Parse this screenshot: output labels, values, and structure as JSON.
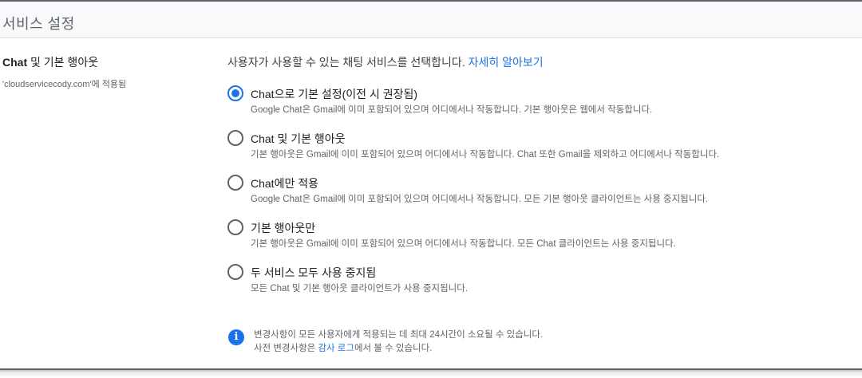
{
  "header": {
    "title": "서비스 설정"
  },
  "left": {
    "title_bold": "Chat",
    "title_rest": " 및 기본 행아웃",
    "subtitle": "'cloudservicecody.com'에 적용됨"
  },
  "main": {
    "intro": "사용자가 사용할 수 있는 채팅 서비스를 선택합니다.",
    "learn_more": "자세히 알아보기",
    "options": [
      {
        "label": "Chat으로 기본 설정(이전 시 권장됨)",
        "desc": "Google Chat은 Gmail에 이미 포함되어 있으며 어디에서나 작동합니다. 기본 행아웃은 웹에서 작동합니다.",
        "checked": true
      },
      {
        "label": "Chat 및 기본 행아웃",
        "desc": "기본 행아웃은 Gmail에 이미 포함되어 있으며 어디에서나 작동합니다. Chat 또한 Gmail을 제외하고 어디에서나 작동합니다.",
        "checked": false
      },
      {
        "label": "Chat에만 적용",
        "desc": "Google Chat은 Gmail에 이미 포함되어 있으며 어디에서나 작동합니다. 모든 기본 행아웃 클라이언트는 사용 중지됩니다.",
        "checked": false
      },
      {
        "label": "기본 행아웃만",
        "desc": "기본 행아웃은 Gmail에 이미 포함되어 있으며 어디에서나 작동합니다. 모든 Chat 클라이언트는 사용 중지됩니다.",
        "checked": false
      },
      {
        "label": "두 서비스 모두 사용 중지됨",
        "desc": "모든 Chat 및 기본 행아웃 클라이언트가 사용 중지됩니다.",
        "checked": false
      }
    ]
  },
  "info": {
    "icon": "info-icon",
    "line1": "변경사항이 모든 사용자에게 적용되는 데 최대 24시간이 소요될 수 있습니다.",
    "line2_prefix": "사전 변경사항은 ",
    "line2_link": "감사 로그",
    "line2_suffix": "에서 볼 수 있습니다."
  },
  "colors": {
    "accent": "#1a73e8",
    "text": "#202124",
    "secondary": "#5f6368",
    "header_bg": "#f8f9fa"
  }
}
